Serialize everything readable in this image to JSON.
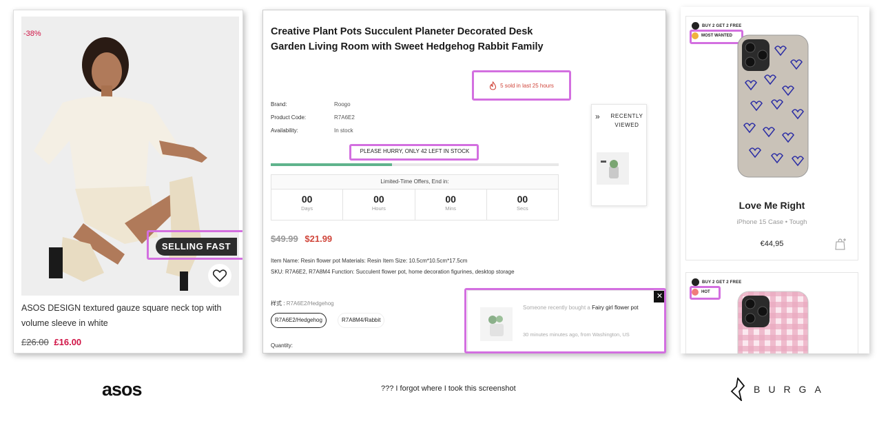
{
  "asos": {
    "discount": "-38%",
    "badge": "SELLING FAST",
    "title": "ASOS DESIGN textured gauze square neck top with volume sleeve in white",
    "old_price": "£26.00",
    "new_price": "£16.00",
    "logo": "asos"
  },
  "shop": {
    "title": "Creative Plant Pots Succulent Planeter Decorated Desk Garden Living Room with Sweet Hedgehog Rabbit Family",
    "sold_text": "5 sold in last 25 hours",
    "brand_label": "Brand:",
    "brand_value": "Roogo",
    "code_label": "Product Code:",
    "code_value": "R7A6E2",
    "avail_label": "Availability:",
    "avail_value": "In stock",
    "hurry": "PLEASE HURRY, ONLY  42  LEFT IN STOCK",
    "stock_fraction": 0.42,
    "offer_heading": "Limited-Time Offers, End in:",
    "countdown": [
      {
        "num": "00",
        "label": "Days"
      },
      {
        "num": "00",
        "label": "Hours"
      },
      {
        "num": "00",
        "label": "Mins"
      },
      {
        "num": "00",
        "label": "Secs"
      }
    ],
    "old_price": "$49.99",
    "new_price": "$21.99",
    "desc_line1": "Item Name: Resin flower pot Materials: Resin Item Size: 10.5cm*10.5cm*17.5cm",
    "desc_line2": "SKU: R7A6E2, R7A8M4 Function: Succulent flower pot, home decoration figurines, desktop storage",
    "style_label": "样式 :",
    "style_value": "R7A6E2/Hedgehog",
    "option_selected": "R7A6E2/Hedgehog",
    "option_other": "R7A8M4/Rabbit",
    "quantity_label": "Quantity:",
    "recently_viewed": "RECENTLY VIEWED",
    "popup_prefix": "Someone recently bought a",
    "popup_product": "Fairy girl flower pot",
    "popup_time": "30 minutes minutes ago, from Washington, US",
    "caption": "??? I forgot where I took this screenshot"
  },
  "burga": {
    "cards": [
      {
        "promo": "BUY 2 GET 2 FREE",
        "tag": "MOST WANTED",
        "name": "Love Me Right",
        "sub": "iPhone 15 Case • Tough",
        "price": "€44,95"
      },
      {
        "promo": "BUY 2 GET 2 FREE",
        "tag": "HOT"
      }
    ],
    "logo": "BURGA"
  },
  "colors": {
    "highlight": "#d36fe0",
    "asos_red": "#d01345",
    "sale_red": "#d0453a",
    "stock_green": "#5fb38c"
  }
}
